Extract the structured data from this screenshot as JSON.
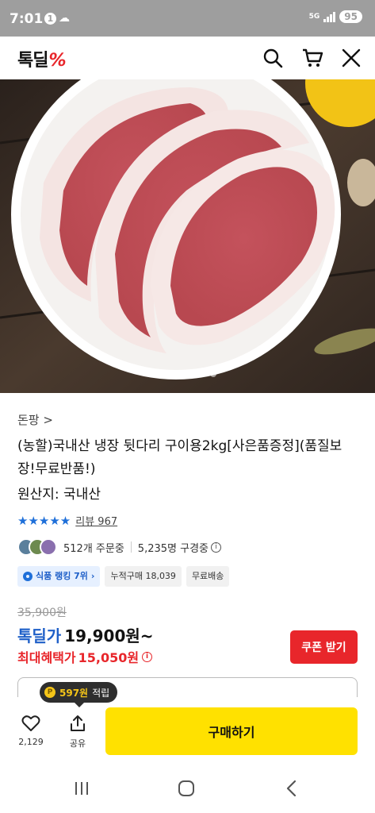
{
  "status_bar": {
    "time": "7:01",
    "notif_badge": "1",
    "network": "5G",
    "battery": "95"
  },
  "header": {
    "logo_text": "톡딜",
    "logo_mark": "%",
    "icons": [
      "search-icon",
      "cart-icon",
      "close-icon"
    ]
  },
  "hero": {
    "image_desc": "raw pork slices on white plate",
    "slide_count": 5,
    "active_slide": 1
  },
  "product": {
    "seller": "돈팡",
    "seller_chevron": ">",
    "title": "(농할)국내산 냉장 뒷다리 구이용2kg[사은품증정](품질보장!무료반품!)",
    "origin": "원산지: 국내산",
    "stars": "★★★★★",
    "review_label": "리뷰 967",
    "orders": "512개 주문중",
    "subscribers": "5,235명 구경중",
    "tags": {
      "rank": "식품 랭킹 7위",
      "cumulative": "누적구매 18,039",
      "shipping": "무료배송"
    },
    "original_price": "35,900원",
    "deal_label": "톡딜가",
    "deal_price": "19,900원~",
    "max_benefit_label": "최대혜택가",
    "max_benefit_price": "15,050원",
    "coupon_button": "쿠폰 받기"
  },
  "bottom_bar": {
    "point_amount": "597원",
    "point_label": "적립",
    "like_count": "2,129",
    "share_label": "공유",
    "buy_button": "구매하기"
  },
  "colors": {
    "brand_red": "#e8262b",
    "brand_yellow": "#ffe100",
    "accent_blue": "#1e5fc8"
  }
}
